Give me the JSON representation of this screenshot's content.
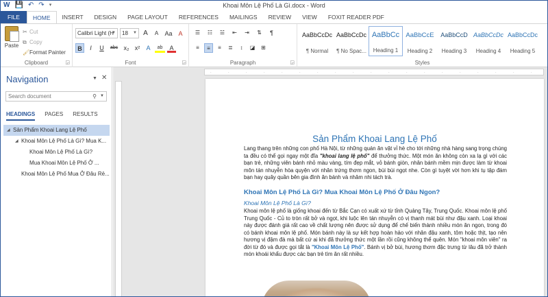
{
  "window": {
    "title": "Khoai Môn Lệ Phố Là Gì.docx - Word",
    "qat": [
      "W",
      "💾",
      "↶",
      "↷",
      "▾"
    ]
  },
  "tabs": [
    "FILE",
    "HOME",
    "INSERT",
    "DESIGN",
    "PAGE LAYOUT",
    "REFERENCES",
    "MAILINGS",
    "REVIEW",
    "VIEW",
    "FOXIT READER PDF"
  ],
  "clipboard": {
    "paste": "Paste",
    "cut": "Cut",
    "copy": "Copy",
    "format_painter": "Format Painter",
    "label": "Clipboard"
  },
  "font": {
    "name": "Calibri Light (H",
    "size": "18",
    "grow": "A",
    "shrink": "A",
    "case": "Aa",
    "clear": "A",
    "bold": "B",
    "italic": "I",
    "underline": "U",
    "strike": "abc",
    "sub": "x₂",
    "sup": "x²",
    "effects": "A",
    "highlight": "ab",
    "color": "A",
    "label": "Font"
  },
  "paragraph": {
    "label": "Paragraph",
    "pilcrow": "¶"
  },
  "styles": {
    "label": "Styles",
    "items": [
      {
        "sample": "AaBbCcDc",
        "name": "¶ Normal"
      },
      {
        "sample": "AaBbCcDc",
        "name": "¶ No Spac..."
      },
      {
        "sample": "AaBbCc",
        "name": "Heading 1"
      },
      {
        "sample": "AaBbCcE",
        "name": "Heading 2"
      },
      {
        "sample": "AaBbCcD",
        "name": "Heading 3"
      },
      {
        "sample": "AaBbCcDc",
        "name": "Heading 4"
      },
      {
        "sample": "AaBbCcDc",
        "name": "Heading 5"
      }
    ]
  },
  "navigation": {
    "title": "Navigation",
    "search_placeholder": "Search document",
    "tabs": [
      "HEADINGS",
      "PAGES",
      "RESULTS"
    ],
    "tree": [
      "Sản Phẩm Khoai Lang Lệ Phố",
      "Khoai Môn Lệ Phố Là Gì? Mua K...",
      "Khoai Môn Lệ Phố Là Gì?",
      "Mua Khoai Môn Lệ Phố Ở ...",
      "Khoai Môn Lệ Phố Mua Ở Đâu Rẻ..."
    ]
  },
  "document": {
    "title": "Sản Phẩm Khoai Lang Lệ Phố",
    "intro_1": "Lang thang trên những con phố Hà Nội, từ những quán ăn vặt vỉ hè cho tới những nhà hàng sang trọng chúng ta đều có thể gọi ngay một đĩa ",
    "intro_em": "\"khoai lang lệ phố\"",
    "intro_2": " để thưởng thức. Một món ăn không còn xa lạ gì với các bạn trẻ, những viên bánh nhỏ màu vàng, tím đẹp mắt, vỏ bánh giòn, nhân bánh mềm mịn được làm từ khoai môn tán nhuyễn hòa quyện với nhân trứng thơm ngon, bùi bùi ngọt nhe. Còn gì tuyệt vời hơn khi tụ tập đám bạn hay quây quần bên gia đình ăn bánh và nhâm nhi tách trà.",
    "heading2": "Khoai Môn Lệ Phố Là Gì? Mua Khoai Môn Lệ Phố Ở Đâu Ngon?",
    "heading3": "Khoai Môn Lệ Phố Là Gì?",
    "body_1": "Khoai môn lệ phố là giống khoai đến từ Bắc Cạn có xuất xứ từ tỉnh Quảng Tây, Trung Quốc. Khoai môn lệ phố Trung Quốc - Củ to tròn rất bở và ngọt, khi luộc lên tán nhuyễn có vị thanh mát bùi như đậu xanh. Loại khoai này được đánh giá rất cao về chất lượng nên được sử dụng để chế biến thành nhiều món ăn ngon, trong đó có bánh khoai môn lệ phố. Món bánh này là sự kết hợp hoàn hảo với nhân đậu xanh, tôm hoặc thịt, tạo nên hương vị đậm đà mà bất cứ ai khi đã thưởng thức một lần rồi cũng không thể quên. Món \"khoai môn viên\" ra đời từ đó và được gọi tắt là ",
    "body_em": "\"Khoai Môn Lệ Phố\"",
    "body_2": ". Bánh vị bở bùi, hương thơm đặc trưng từ lâu đã trở thành món khoái khẩu được các bạn trẻ tìm ăn rất nhiều."
  }
}
